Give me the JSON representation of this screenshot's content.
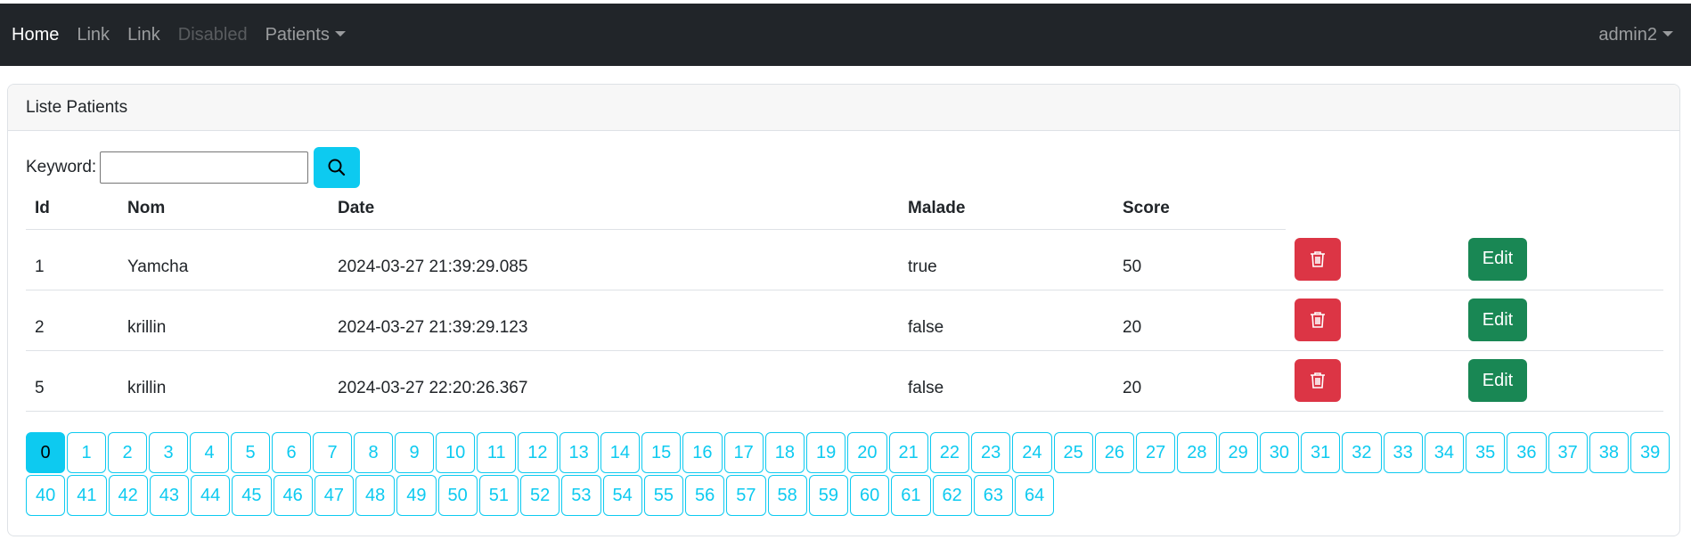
{
  "navbar": {
    "links": [
      {
        "label": "Home",
        "state": "active"
      },
      {
        "label": "Link",
        "state": "normal"
      },
      {
        "label": "Link",
        "state": "normal"
      },
      {
        "label": "Disabled",
        "state": "disabled"
      }
    ],
    "patients_dropdown": "Patients",
    "user_dropdown": "admin2"
  },
  "card": {
    "title": "Liste Patients",
    "search": {
      "label": "Keyword:",
      "value": "",
      "placeholder": ""
    }
  },
  "table": {
    "headers": [
      "Id",
      "Nom",
      "Date",
      "Malade",
      "Score"
    ],
    "rows": [
      {
        "id": "1",
        "nom": "Yamcha",
        "date": "2024-03-27 21:39:29.085",
        "malade": "true",
        "score": "50"
      },
      {
        "id": "2",
        "nom": "krillin",
        "date": "2024-03-27 21:39:29.123",
        "malade": "false",
        "score": "20"
      },
      {
        "id": "5",
        "nom": "krillin",
        "date": "2024-03-27 22:20:26.367",
        "malade": "false",
        "score": "20"
      }
    ],
    "edit_label": "Edit"
  },
  "pagination": {
    "current": "0",
    "pages": [
      "0",
      "1",
      "2",
      "3",
      "4",
      "5",
      "6",
      "7",
      "8",
      "9",
      "10",
      "11",
      "12",
      "13",
      "14",
      "15",
      "16",
      "17",
      "18",
      "19",
      "20",
      "21",
      "22",
      "23",
      "24",
      "25",
      "26",
      "27",
      "28",
      "29",
      "30",
      "31",
      "32",
      "33",
      "34",
      "35",
      "36",
      "37",
      "38",
      "39",
      "40",
      "41",
      "42",
      "43",
      "44",
      "45",
      "46",
      "47",
      "48",
      "49",
      "50",
      "51",
      "52",
      "53",
      "54",
      "55",
      "56",
      "57",
      "58",
      "59",
      "60",
      "61",
      "62",
      "63",
      "64"
    ]
  },
  "colors": {
    "navbar": "#212529",
    "info": "#0dcaf0",
    "danger": "#dc3545",
    "success": "#198754"
  }
}
